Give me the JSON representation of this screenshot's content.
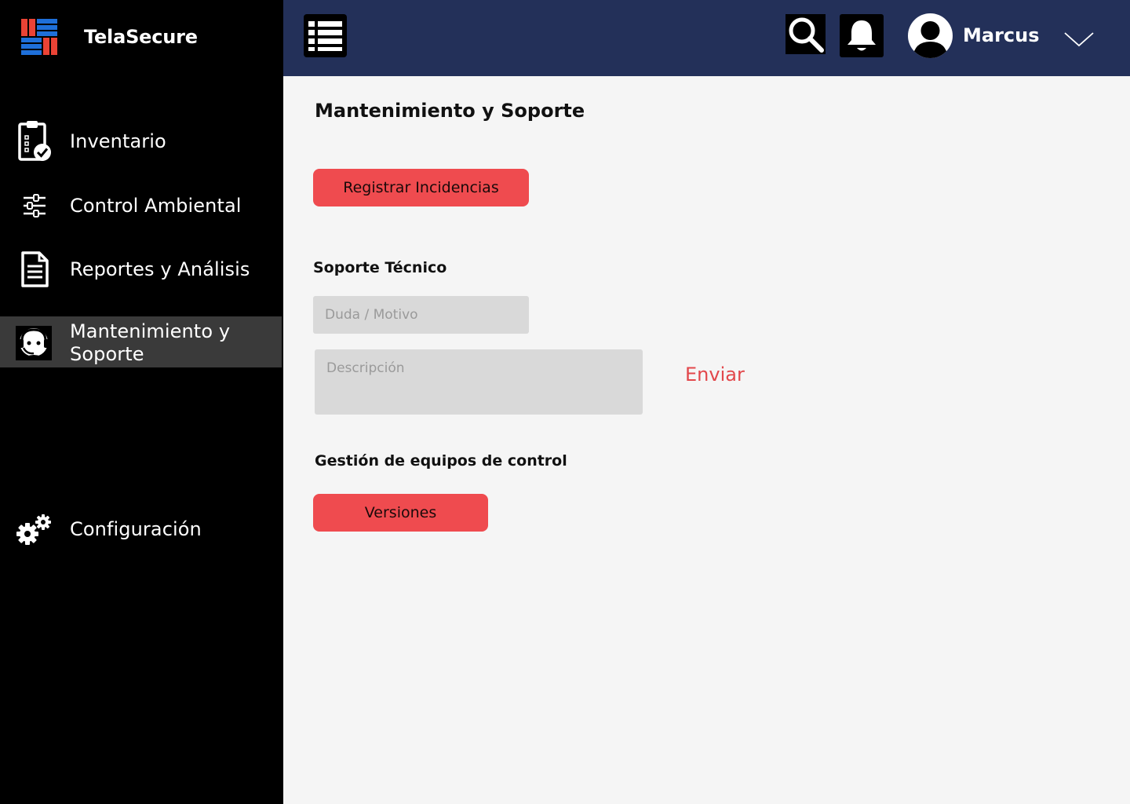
{
  "brand": {
    "name": "TelaSecure",
    "logo": "brand-logo-icon"
  },
  "sidebar": {
    "items": [
      {
        "label": "Inventario",
        "icon": "clipboard-check-icon"
      },
      {
        "label": "Control Ambiental",
        "icon": "sliders-icon"
      },
      {
        "label": "Reportes y Análisis",
        "icon": "document-icon"
      },
      {
        "label_line1": "Mantenimiento y",
        "label_line2": "Soporte",
        "icon": "support-agent-icon",
        "active": true
      },
      {
        "label": "Configuración",
        "icon": "gears-icon"
      }
    ]
  },
  "topbar": {
    "menu_icon": "list-menu-icon",
    "search_icon": "search-icon",
    "bell_icon": "bell-icon",
    "user_name": "Marcus"
  },
  "main": {
    "title": "Mantenimiento y Soporte",
    "register_button": "Registrar Incidencias",
    "support": {
      "title": "Soporte Técnico",
      "subject_placeholder": "Duda / Motivo",
      "subject_value": "",
      "description_placeholder": "Descripción",
      "description_value": "",
      "send_label": "Enviar"
    },
    "equipment": {
      "title": "Gestión de equipos de control",
      "versions_button": "Versiones"
    }
  },
  "colors": {
    "sidebar_bg": "#000000",
    "topbar_bg": "#233059",
    "accent_red": "#ef4b4f",
    "active_item_bg": "#3a3a3a",
    "main_bg": "#f5f5f5",
    "field_bg": "#d9d9d9"
  }
}
